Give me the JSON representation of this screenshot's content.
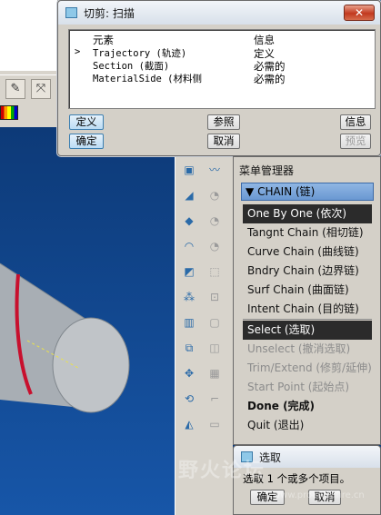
{
  "sweep_dialog": {
    "title": "切剪: 扫描",
    "close_label": "✕",
    "columns": {
      "element": "元素",
      "info": "信息"
    },
    "rows": [
      {
        "marker": ">",
        "element": "Trajectory (轨迹)",
        "info": "定义"
      },
      {
        "marker": "",
        "element": "Section (截面)",
        "info": "必需的"
      },
      {
        "marker": "",
        "element": "MaterialSide (材料侧",
        "info": "必需的"
      }
    ],
    "buttons": {
      "define": "定义",
      "refs": "参照",
      "info": "信息",
      "ok": "确定",
      "cancel": "取消",
      "preview": "预览"
    }
  },
  "menu_manager": {
    "title": "菜单管理器",
    "header": "CHAIN (链)",
    "items": [
      {
        "label": "One By One (依次)",
        "state": "highlighted"
      },
      {
        "label": "Tangnt Chain (相切链)",
        "state": "normal"
      },
      {
        "label": "Curve Chain (曲线链)",
        "state": "normal"
      },
      {
        "label": "Bndry Chain (边界链)",
        "state": "normal"
      },
      {
        "label": "Surf Chain (曲面链)",
        "state": "normal"
      },
      {
        "label": "Intent Chain (目的链)",
        "state": "normal"
      },
      {
        "label": "Select (选取)",
        "state": "highlighted"
      },
      {
        "label": "Unselect (撤消选取)",
        "state": "disabled"
      },
      {
        "label": "Trim/Extend (修剪/延伸)",
        "state": "disabled"
      },
      {
        "label": "Start Point (起始点)",
        "state": "disabled"
      },
      {
        "label": "Done (完成)",
        "state": "bold"
      },
      {
        "label": "Quit (退出)",
        "state": "normal"
      }
    ]
  },
  "select_dialog": {
    "title": "选取",
    "prompt": "选取 1 个或多个项目。",
    "ok": "确定",
    "cancel": "取消"
  },
  "watermark": {
    "text": "野火论坛",
    "url": "www.proewildfire.cn"
  },
  "colors": {
    "viewport_blue": "#1250a0",
    "curve_red": "#c8102e",
    "highlight_dark": "#2b2b2b",
    "chain_header_blue": "#7aa6dc"
  },
  "icons": {
    "left_toolbar": [
      "sketch-pen-icon",
      "axis-icon"
    ],
    "tool_column": [
      "datum-plane-icon",
      "sketch-curve-icon",
      "datum-axis-icon",
      "datum-point-icon",
      "cs-icon",
      "shell-icon",
      "round-icon",
      "draft-icon",
      "pattern-icon",
      "mirror-icon",
      "merge-icon",
      "trim-icon",
      "hole-icon",
      "rib-icon"
    ]
  }
}
